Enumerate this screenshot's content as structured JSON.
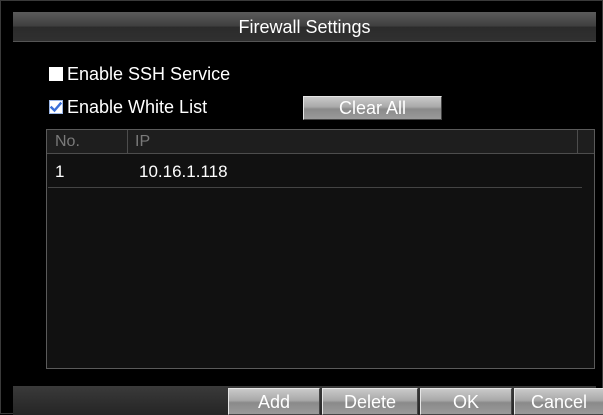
{
  "dialog": {
    "title": "Firewall Settings"
  },
  "options": {
    "ssh": {
      "label": "Enable SSH Service",
      "checked": false
    },
    "whitelist": {
      "label": "Enable White List",
      "checked": true
    },
    "clear_all_label": "Clear All"
  },
  "table": {
    "columns": [
      "No.",
      "IP"
    ],
    "rows": [
      {
        "no": "1",
        "ip": "10.16.1.118"
      }
    ]
  },
  "footer": {
    "add_label": "Add",
    "delete_label": "Delete",
    "ok_label": "OK",
    "cancel_label": "Cancel"
  },
  "colors": {
    "background": "#000000",
    "checkbox_check": "#3a6fd8"
  }
}
